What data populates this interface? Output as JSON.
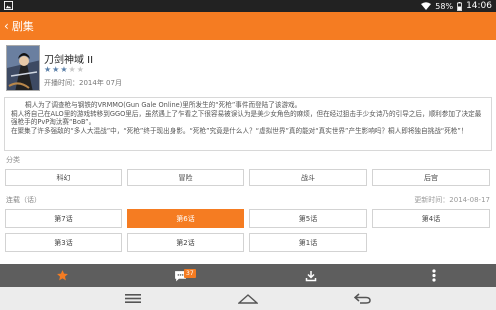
{
  "status_bar": {
    "battery": "58%",
    "time": "14:06"
  },
  "action_bar": {
    "title": "剧集"
  },
  "anime": {
    "title": "刀剑神域 II",
    "rating_filled": 3,
    "rating_total": 5,
    "air_date": "开播时间：2014年 07月",
    "description": [
      "桐人为了调查枪与钢铁的VRMMO(Gun Gale Online)里所发生的“死枪”事件而登陆了该游戏。",
      "桐人将自己在ALO里的游戏转移到GGO里后，虽然遇上了乍看之下很容易被误认为是美少女角色的麻烦，但在经过狙击手少女诗乃的引导之后，顺利参加了决定最强枪手的PvP淘汰赛“BoB”。",
      "在聚集了许多强敌的“多人大混战”中，“死枪”终于现出身影。“死枪”究竟是什么人？“虚拟世界”真的能对“真实世界”产生影响吗？桐人即将独自挑战“死枪”！"
    ]
  },
  "categories": {
    "label": "分类",
    "items": [
      "科幻",
      "冒险",
      "战斗",
      "后宫"
    ]
  },
  "episodes": {
    "label": "连载（话）",
    "update": "更新时间：2014-08-17",
    "items": [
      "第7话",
      "第6话",
      "第5话",
      "第4话",
      "第3话",
      "第2话",
      "第1话"
    ],
    "active_index": 1
  },
  "bottom_bar": {
    "comment_count": "37"
  }
}
